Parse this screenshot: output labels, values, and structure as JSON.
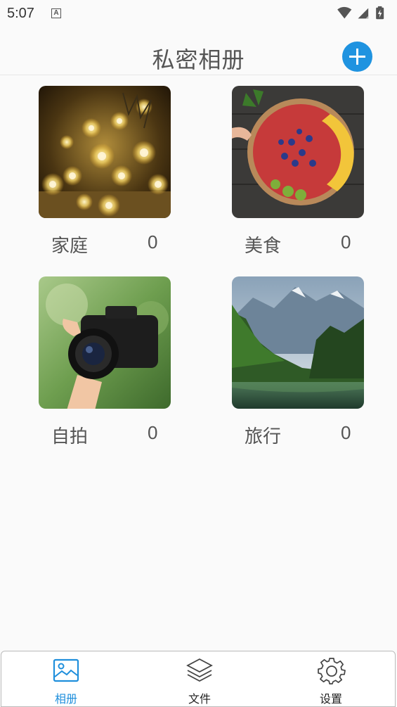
{
  "status_bar": {
    "time": "5:07",
    "notification_icon": "A"
  },
  "header": {
    "title": "私密相册",
    "add_icon": "plus-circle-icon"
  },
  "albums": [
    {
      "name": "家庭",
      "count": "0"
    },
    {
      "name": "美食",
      "count": "0"
    },
    {
      "name": "自拍",
      "count": "0"
    },
    {
      "name": "旅行",
      "count": "0"
    }
  ],
  "bottom_nav": [
    {
      "label": "相册",
      "icon": "image-icon",
      "active": true
    },
    {
      "label": "文件",
      "icon": "layers-icon",
      "active": false
    },
    {
      "label": "设置",
      "icon": "gear-icon",
      "active": false
    }
  ],
  "colors": {
    "accent": "#1f93e0",
    "text": "#555555",
    "background": "#fafafa"
  }
}
